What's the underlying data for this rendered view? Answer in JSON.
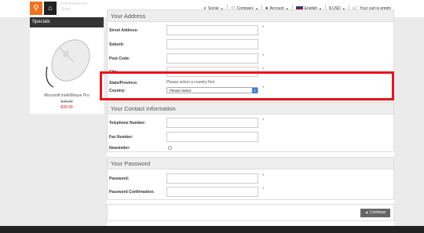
{
  "header": {
    "faded_line1": "Electronics Pro",
    "faded_line2": "Shop",
    "social": "Social",
    "company": "Company",
    "account": "Account",
    "language": "English",
    "currency": "$ USD",
    "cart": "Your cart is empty"
  },
  "sidebar": {
    "specials_title": "Specials",
    "product_name": "Microsoft IntelliMouse Pro",
    "old_price": "$49.99",
    "new_price": "$39.99"
  },
  "address": {
    "title": "Your Address",
    "street_label": "Street Address:",
    "suburb_label": "Suburb:",
    "postcode_label": "Post Code:",
    "city_label": "City:",
    "state_label": "State/Province:",
    "state_hint": "Please select a country first",
    "country_label": "Country:",
    "country_value": "Please Select",
    "required_mark": "*"
  },
  "contact": {
    "title": "Your Contact Information",
    "telephone_label": "Telephone Number:",
    "fax_label": "Fax Number:",
    "newsletter_label": "Newsletter:"
  },
  "password": {
    "title": "Your Password",
    "password_label": "Password:",
    "confirm_label": "Password Confirmation:"
  },
  "actions": {
    "continue_label": "Continue"
  },
  "colors": {
    "accent": "#f2721c",
    "highlight": "#e8141c",
    "select_arrow": "#3b7fd9"
  }
}
